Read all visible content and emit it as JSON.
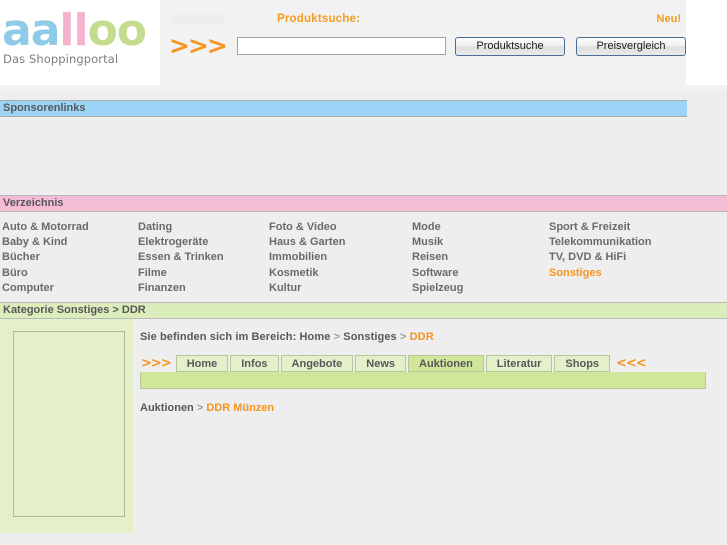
{
  "brand": {
    "logo_part1": "aa",
    "logo_part2": "ll",
    "logo_part3": "oo",
    "tagline": "Das Shoppingportal",
    "color_blue": "#8ecbe8",
    "color_pink": "#f3b3ce",
    "color_green": "#c3dc8d",
    "accent_orange": "#f79421"
  },
  "header": {
    "product_search_label": "Produktsuche:",
    "new_badge": "Neu!",
    "forward_arrows": ">>>",
    "search_value": "",
    "search_placeholder": "",
    "button_search": "Produktsuche",
    "button_compare": "Preisvergleich"
  },
  "sponsors": {
    "title": "Sponsorenlinks"
  },
  "directory": {
    "title": "Verzeichnis",
    "columns": [
      {
        "items": [
          {
            "label": "Auto & Motorrad",
            "active": false
          },
          {
            "label": "Baby & Kind",
            "active": false
          },
          {
            "label": "Bücher",
            "active": false
          },
          {
            "label": "Büro",
            "active": false
          },
          {
            "label": "Computer",
            "active": false
          }
        ]
      },
      {
        "items": [
          {
            "label": "Dating",
            "active": false
          },
          {
            "label": "Elektrogeräte",
            "active": false
          },
          {
            "label": "Essen & Trinken",
            "active": false
          },
          {
            "label": "Filme",
            "active": false
          },
          {
            "label": "Finanzen",
            "active": false
          }
        ]
      },
      {
        "items": [
          {
            "label": "Foto & Video",
            "active": false
          },
          {
            "label": "Haus & Garten",
            "active": false
          },
          {
            "label": "Immobilien",
            "active": false
          },
          {
            "label": "Kosmetik",
            "active": false
          },
          {
            "label": "Kultur",
            "active": false
          }
        ]
      },
      {
        "items": [
          {
            "label": "Mode",
            "active": false
          },
          {
            "label": "Musik",
            "active": false
          },
          {
            "label": "Reisen",
            "active": false
          },
          {
            "label": "Software",
            "active": false
          },
          {
            "label": "Spielzeug",
            "active": false
          }
        ]
      },
      {
        "items": [
          {
            "label": "Sport & Freizeit",
            "active": false
          },
          {
            "label": "Telekommunikation",
            "active": false
          },
          {
            "label": "TV, DVD & HiFi",
            "active": false
          },
          {
            "label": "Sonstiges",
            "active": true
          }
        ]
      }
    ]
  },
  "category": {
    "bar_title": "Kategorie Sonstiges > DDR",
    "breadcrumb_prefix": "Sie befinden sich im Bereich: Home",
    "breadcrumb_sep1": " > ",
    "breadcrumb_mid": "Sonstiges",
    "breadcrumb_sep2": " > ",
    "breadcrumb_current": "DDR"
  },
  "tabs": {
    "forward_arrows": ">>>",
    "back_arrows": "<<<",
    "items": [
      {
        "label": "Home",
        "active": false
      },
      {
        "label": "Infos",
        "active": false
      },
      {
        "label": "Angebote",
        "active": false
      },
      {
        "label": "News",
        "active": false
      },
      {
        "label": "Auktionen",
        "active": true
      },
      {
        "label": "Literatur",
        "active": false
      },
      {
        "label": "Shops",
        "active": false
      }
    ]
  },
  "subcrumb": {
    "section": "Auktionen",
    "sep": " > ",
    "current": "DDR Münzen"
  }
}
